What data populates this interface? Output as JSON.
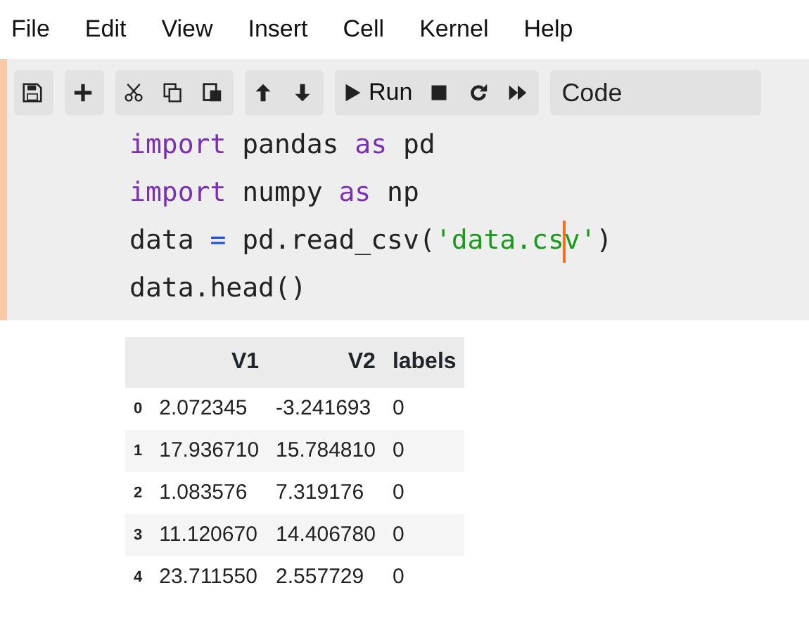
{
  "menu": [
    "File",
    "Edit",
    "View",
    "Insert",
    "Cell",
    "Kernel",
    "Help"
  ],
  "toolbar": {
    "groups": [
      [
        {
          "kind": "save"
        }
      ],
      [
        {
          "kind": "add"
        }
      ],
      [
        {
          "kind": "cut"
        },
        {
          "kind": "copy"
        },
        {
          "kind": "paste"
        }
      ],
      [
        {
          "kind": "up"
        },
        {
          "kind": "down"
        }
      ],
      [
        {
          "kind": "run",
          "label": "Run"
        },
        {
          "kind": "stop"
        },
        {
          "kind": "restart"
        },
        {
          "kind": "fast-forward"
        }
      ]
    ],
    "cell_type": "Code"
  },
  "cell": {
    "selected": true,
    "lines": [
      [
        {
          "kind": "keyword",
          "text": "import"
        },
        {
          "kind": "name",
          "text": " pandas "
        },
        {
          "kind": "keyword",
          "text": "as"
        },
        {
          "kind": "name",
          "text": " pd"
        }
      ],
      [
        {
          "kind": "keyword",
          "text": "import"
        },
        {
          "kind": "name",
          "text": " numpy "
        },
        {
          "kind": "keyword",
          "text": "as"
        },
        {
          "kind": "name",
          "text": " np"
        }
      ],
      [
        {
          "kind": "name",
          "text": "data "
        },
        {
          "kind": "operator",
          "text": "="
        },
        {
          "kind": "name",
          "text": " pd.read_csv("
        },
        {
          "kind": "string",
          "text": "'data.cs",
          "cursor_after": true
        },
        {
          "kind": "string",
          "text": "v'"
        },
        {
          "kind": "name",
          "text": ")"
        }
      ],
      [
        {
          "kind": "name",
          "text": "data.head()"
        }
      ]
    ]
  },
  "output_table": {
    "columns": [
      "",
      "V1",
      "V2",
      "labels"
    ],
    "rows": [
      [
        "0",
        "2.072345",
        "-3.241693",
        "0"
      ],
      [
        "1",
        "17.936710",
        "15.784810",
        "0"
      ],
      [
        "2",
        "1.083576",
        "7.319176",
        "0"
      ],
      [
        "3",
        "11.120670",
        "14.406780",
        "0"
      ],
      [
        "4",
        "23.711550",
        "2.557729",
        "0"
      ]
    ]
  }
}
